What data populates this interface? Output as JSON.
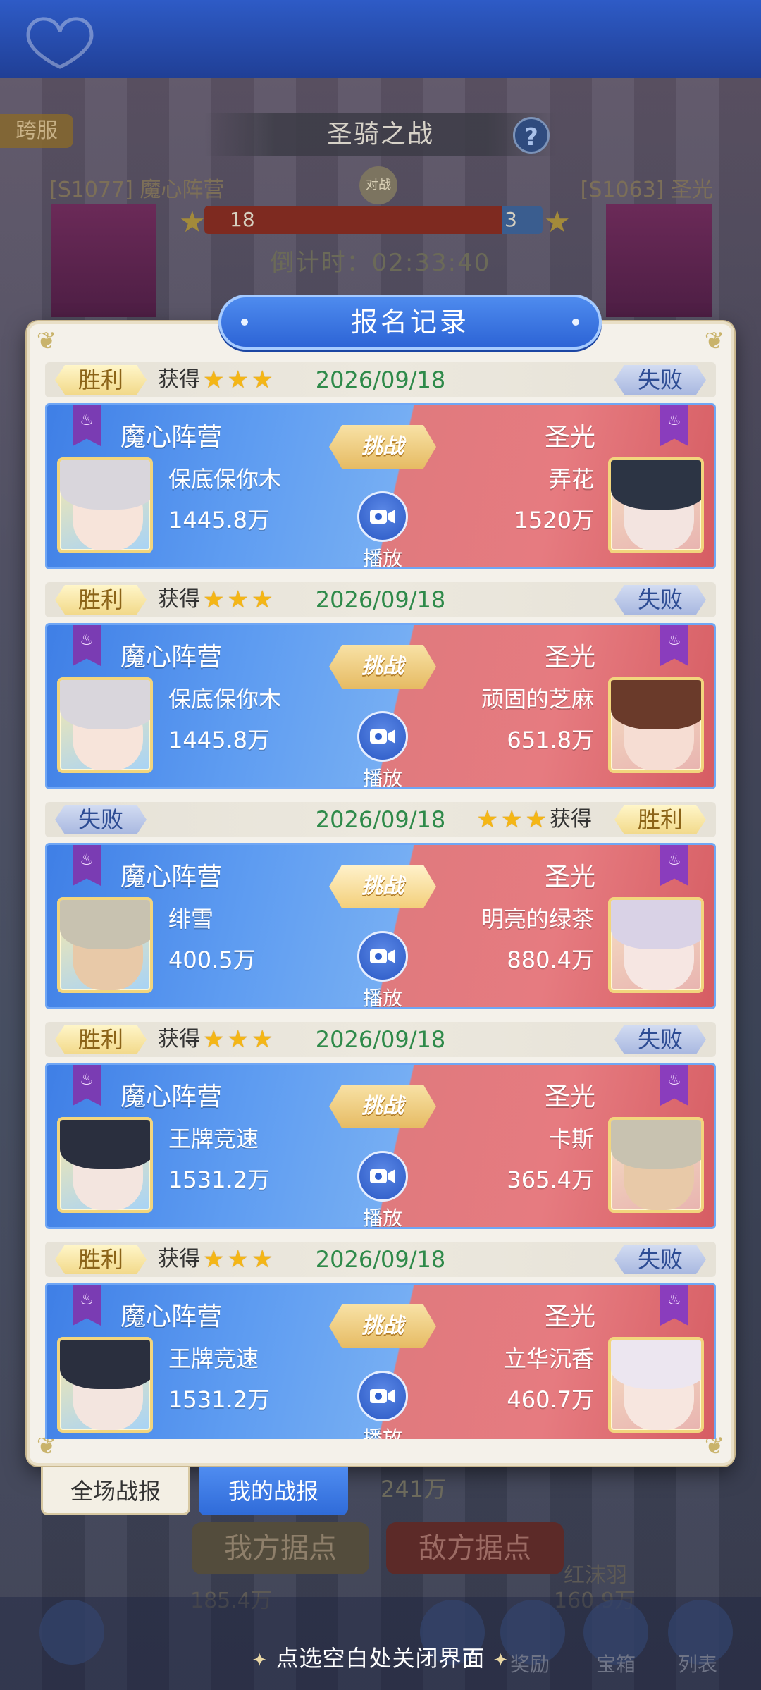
{
  "background": {
    "cross_server_label": "跨服",
    "war_title": "圣骑之战",
    "help_label": "?",
    "left_faction": "[S1077] 魔心阵营",
    "right_faction": "[S1063] 圣光",
    "vs_label": "对战",
    "left_score": "18",
    "right_score": "3",
    "countdown": "倒计时：02:33:40",
    "amount_dim": "241万",
    "btn_our_base": "我方据点",
    "btn_enemy_base": "敌方据点",
    "dim_left_value": "185.4万",
    "dim_right_value": "160.9万",
    "dim_right_name": "红沫羽",
    "bottom_labels": {
      "reward": "奖励",
      "chest": "宝箱",
      "list": "列表"
    }
  },
  "panel": {
    "title": "报名记录"
  },
  "labels": {
    "win": "胜利",
    "lose": "失败",
    "gain": "获得",
    "challenge": "挑战",
    "play": "播放"
  },
  "records": [
    {
      "date": "2026/09/18",
      "left_result": "胜利",
      "right_result": "失败",
      "stars_side": "left",
      "left_camp": "魔心阵营",
      "right_camp": "圣光",
      "left_name": "保底保你木",
      "left_power": "1445.8万",
      "right_name": "弄花",
      "right_power": "1520万"
    },
    {
      "date": "2026/09/18",
      "left_result": "胜利",
      "right_result": "失败",
      "stars_side": "left",
      "left_camp": "魔心阵营",
      "right_camp": "圣光",
      "left_name": "保底保你木",
      "left_power": "1445.8万",
      "right_name": "顽固的芝麻",
      "right_power": "651.8万"
    },
    {
      "date": "2026/09/18",
      "left_result": "失败",
      "right_result": "胜利",
      "stars_side": "right",
      "left_camp": "魔心阵营",
      "right_camp": "圣光",
      "left_name": "绯雪",
      "left_power": "400.5万",
      "right_name": "明亮的绿茶",
      "right_power": "880.4万"
    },
    {
      "date": "2026/09/18",
      "left_result": "胜利",
      "right_result": "失败",
      "stars_side": "left",
      "left_camp": "魔心阵营",
      "right_camp": "圣光",
      "left_name": "王牌竞速",
      "left_power": "1531.2万",
      "right_name": "卡斯",
      "right_power": "365.4万"
    },
    {
      "date": "2026/09/18",
      "left_result": "胜利",
      "right_result": "失败",
      "stars_side": "left",
      "left_camp": "魔心阵营",
      "right_camp": "圣光",
      "left_name": "王牌竞速",
      "left_power": "1531.2万",
      "right_name": "立华沉香",
      "right_power": "460.7万"
    }
  ],
  "tabs": {
    "all": "全场战报",
    "mine": "我的战报"
  },
  "close_hint": "点选空白处关闭界面",
  "colors": {
    "blue_side": "#3f7fe6",
    "red_side": "#e67b80",
    "date_green": "#2f8a4a",
    "star_gold": "#f4b616"
  }
}
